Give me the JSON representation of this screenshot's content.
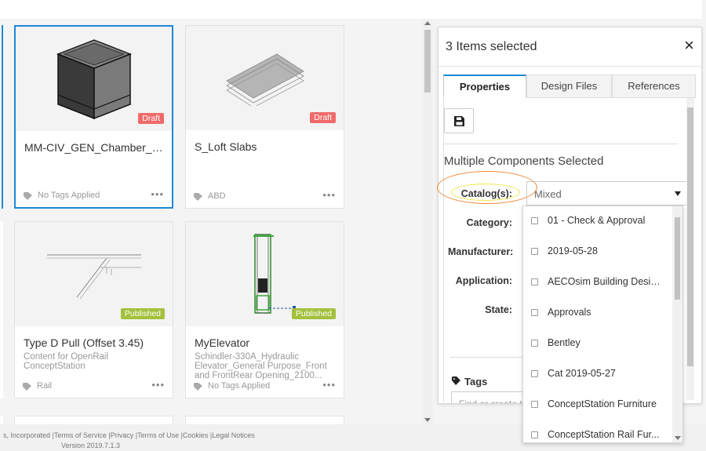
{
  "cards": [
    {
      "title": "MM-CIV_GEN_Chamber_Va...",
      "badge": "Draft",
      "tag": "No Tags Applied",
      "desc": ""
    },
    {
      "title": "S_Loft Slabs",
      "badge": "Draft",
      "tag": "ABD",
      "desc": ""
    },
    {
      "title": "Type D Pull (Offset 3.45)",
      "badge": "Published",
      "tag": "Rail",
      "desc": "Content for OpenRail ConceptStation"
    },
    {
      "title": "MyElevator",
      "badge": "Published",
      "tag": "No Tags Applied",
      "desc": "Schindler-330A_Hydraulic Elevator_General Purpose_Front and FrontRear Opening_2100..."
    }
  ],
  "card_more": "•••",
  "panel": {
    "title": "3 Items selected",
    "close": "×",
    "tabs": [
      "Properties",
      "Design Files",
      "References"
    ],
    "section_title": "Multiple Components Selected",
    "labels": {
      "catalogs": "Catalog(s):",
      "category": "Category:",
      "manufacturer": "Manufacturer:",
      "application": "Application:",
      "state": "State:"
    },
    "catalog_value": "Mixed",
    "tags_label": "Tags",
    "tags_placeholder": "Find or create t"
  },
  "dropdown_options": [
    "01 - Check & Approval",
    "2019-05-28",
    "AECOsim Building Desig...",
    "Approvals",
    "Bentley",
    "Cat 2019-05-27",
    "ConceptStation Furniture",
    "ConceptStation Rail Fur..."
  ],
  "footer": {
    "links": "s, Incorporated  |Terms of Service  |Privacy  |Terms of Use  |Cookies  |Legal Notices",
    "version": "Version 2019.7.1.3"
  },
  "colors": {
    "accent": "#1e88d6",
    "draft": "#ef6a6a",
    "published": "#a4c03c",
    "annotation_orange": "#f08a3c",
    "annotation_yellow": "#f2e640"
  }
}
